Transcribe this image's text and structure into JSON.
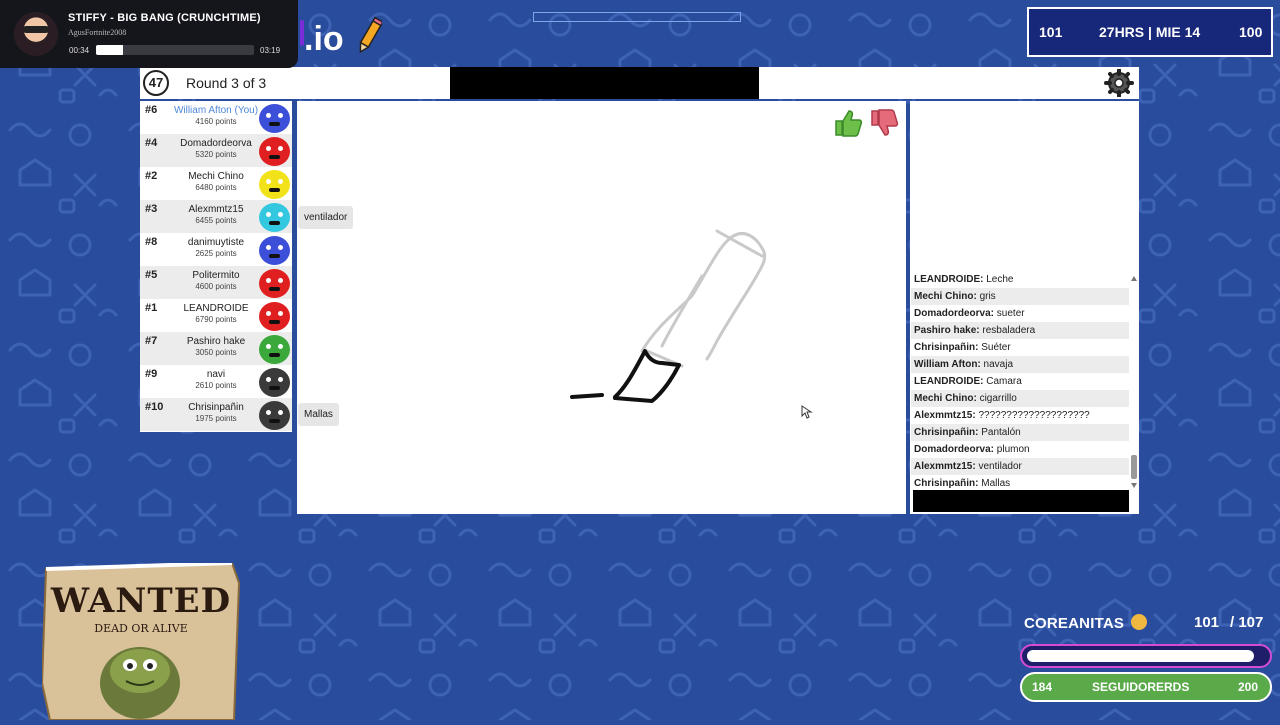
{
  "music": {
    "title": "STIFFY - BIG BANG (CRUNCHTIME)",
    "artist": "AgusFortnite2008",
    "elapsed": "00:34",
    "duration": "03:19",
    "progress_fraction": 0.17
  },
  "logo": {
    "text": ".io"
  },
  "stats": {
    "left": "101",
    "center": "27HRS | MIE 14",
    "right": "100"
  },
  "topbar": {
    "timer": "47",
    "round": "Round 3 of 3"
  },
  "players": [
    {
      "rank": "#6",
      "name": "William Afton (You)",
      "points": "4160 points",
      "color": "#3b4fd8",
      "self": true
    },
    {
      "rank": "#4",
      "name": "Domadordeorva",
      "points": "5320 points",
      "color": "#e02020"
    },
    {
      "rank": "#2",
      "name": "Mechi Chino",
      "points": "6480 points",
      "color": "#f2e21a"
    },
    {
      "rank": "#3",
      "name": "Alexmmtz15",
      "points": "6455 points",
      "color": "#34c8e0"
    },
    {
      "rank": "#8",
      "name": "danimuytiste",
      "points": "2625 points",
      "color": "#3b4fd8"
    },
    {
      "rank": "#5",
      "name": "Politermito",
      "points": "4600 points",
      "color": "#e02020"
    },
    {
      "rank": "#1",
      "name": "LEANDROIDE",
      "points": "6790 points",
      "color": "#e02020"
    },
    {
      "rank": "#7",
      "name": "Pashiro hake",
      "points": "3050 points",
      "color": "#3aa83a"
    },
    {
      "rank": "#9",
      "name": "navi",
      "points": "2610 points",
      "color": "#3a3a3a"
    },
    {
      "rank": "#10",
      "name": "Chrisinpañin",
      "points": "1975 points",
      "color": "#3a3a3a"
    }
  ],
  "bubbles": {
    "alex": "ventilador",
    "chris": "Mallas"
  },
  "chat": [
    {
      "user": "LEANDROIDE:",
      "msg": "Leche"
    },
    {
      "user": "Mechi Chino:",
      "msg": "gris"
    },
    {
      "user": "Domadordeorva:",
      "msg": "sueter"
    },
    {
      "user": "Pashiro hake:",
      "msg": "resbaladera"
    },
    {
      "user": "Chrisinpañin:",
      "msg": "Suéter"
    },
    {
      "user": "William Afton:",
      "msg": "navaja"
    },
    {
      "user": "LEANDROIDE:",
      "msg": "Camara"
    },
    {
      "user": "Mechi Chino:",
      "msg": "cigarrillo"
    },
    {
      "user": "Alexmmtz15:",
      "msg": "????????????????????"
    },
    {
      "user": "Chrisinpañin:",
      "msg": "Pantalón"
    },
    {
      "user": "Domadordeorva:",
      "msg": "plumon"
    },
    {
      "user": "Alexmmtz15:",
      "msg": "ventilador"
    },
    {
      "user": "Chrisinpañin:",
      "msg": "Mallas"
    }
  ],
  "wanted": {
    "title": "WANTED",
    "subtitle": "DEAD OR ALIVE"
  },
  "goal": {
    "label": "COREANITAS",
    "current": "101",
    "target": "/ 107",
    "progress_fraction": 0.94,
    "followers_current": "184",
    "followers_label": "SEGUIDORERDS",
    "followers_target": "200"
  },
  "colors": {
    "background": "#2a4c9c",
    "stats_bg": "#17277a",
    "follow_green": "#5aaa4a"
  }
}
